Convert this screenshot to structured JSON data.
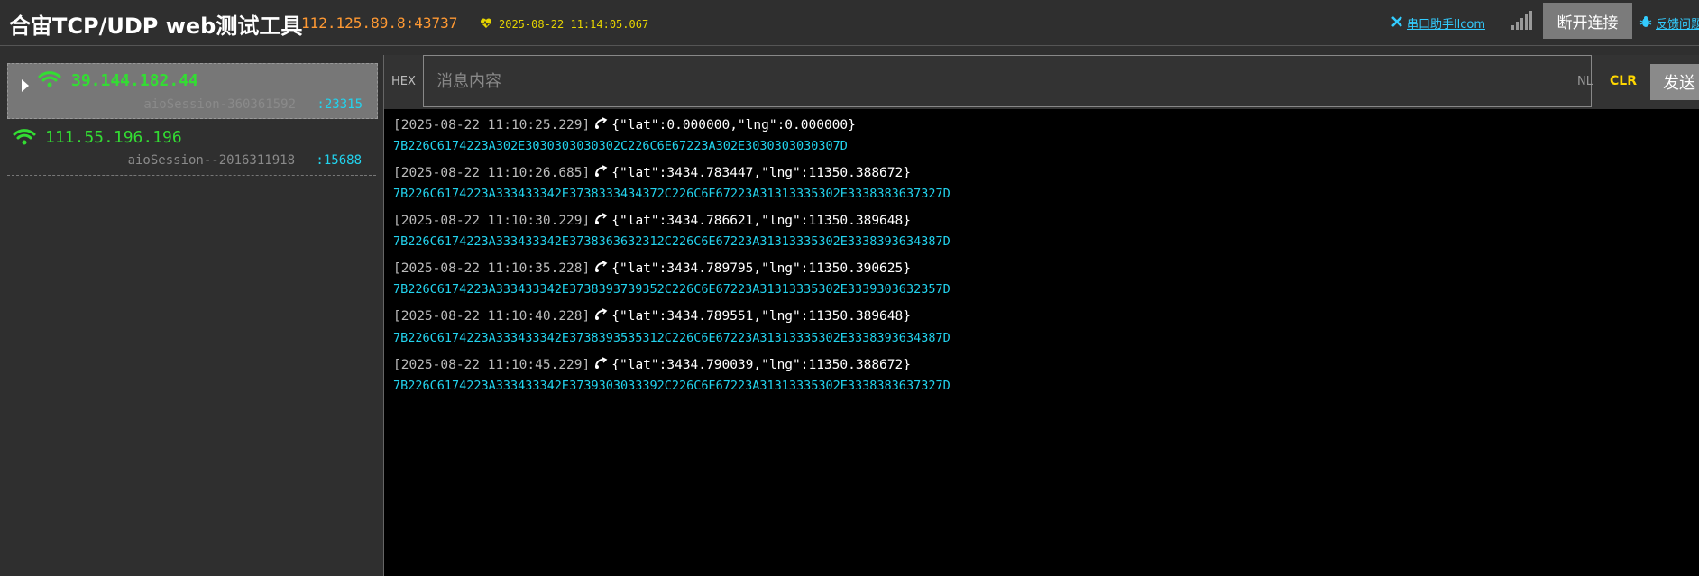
{
  "header": {
    "title": "合宙TCP/UDP web测试工具",
    "server_addr": "112.125.89.8:43737",
    "server_time": "2025-08-22 11:14:05.067",
    "link_serial": "串口助手llcom",
    "disconnect_label": "断开连接",
    "link_feedback": "反馈问题"
  },
  "sessions": [
    {
      "ip": "39.144.182.44",
      "session_id": "aioSession-360361592",
      "port": ":23315",
      "active": true
    },
    {
      "ip": "111.55.196.196",
      "session_id": "aioSession--2016311918",
      "port": ":15688",
      "active": false
    }
  ],
  "inputbar": {
    "hex_label": "HEX",
    "placeholder": "消息内容",
    "nl_label": "NL",
    "clr_label": "CLR",
    "send_label": "发送"
  },
  "log": [
    {
      "ts": "[2025-08-22 11:10:25.229]",
      "payload": "{\"lat\":0.000000,\"lng\":0.000000}",
      "hex": "7B226C6174223A302E3030303030302C226C6E67223A302E3030303030307D"
    },
    {
      "ts": "[2025-08-22 11:10:26.685]",
      "payload": "{\"lat\":3434.783447,\"lng\":11350.388672}",
      "hex": "7B226C6174223A333433342E3738333434372C226C6E67223A31313335302E3338383637327D"
    },
    {
      "ts": "[2025-08-22 11:10:30.229]",
      "payload": "{\"lat\":3434.786621,\"lng\":11350.389648}",
      "hex": "7B226C6174223A333433342E3738363632312C226C6E67223A31313335302E3338393634387D"
    },
    {
      "ts": "[2025-08-22 11:10:35.228]",
      "payload": "{\"lat\":3434.789795,\"lng\":11350.390625}",
      "hex": "7B226C6174223A333433342E3738393739352C226C6E67223A31313335302E3339303632357D"
    },
    {
      "ts": "[2025-08-22 11:10:40.228]",
      "payload": "{\"lat\":3434.789551,\"lng\":11350.389648}",
      "hex": "7B226C6174223A333433342E3738393535312C226C6E67223A31313335302E3338393634387D"
    },
    {
      "ts": "[2025-08-22 11:10:45.229]",
      "payload": "{\"lat\":3434.790039,\"lng\":11350.388672}",
      "hex": "7B226C6174223A333433342E3739303033392C226C6E67223A31313335302E3338383637327D"
    }
  ]
}
